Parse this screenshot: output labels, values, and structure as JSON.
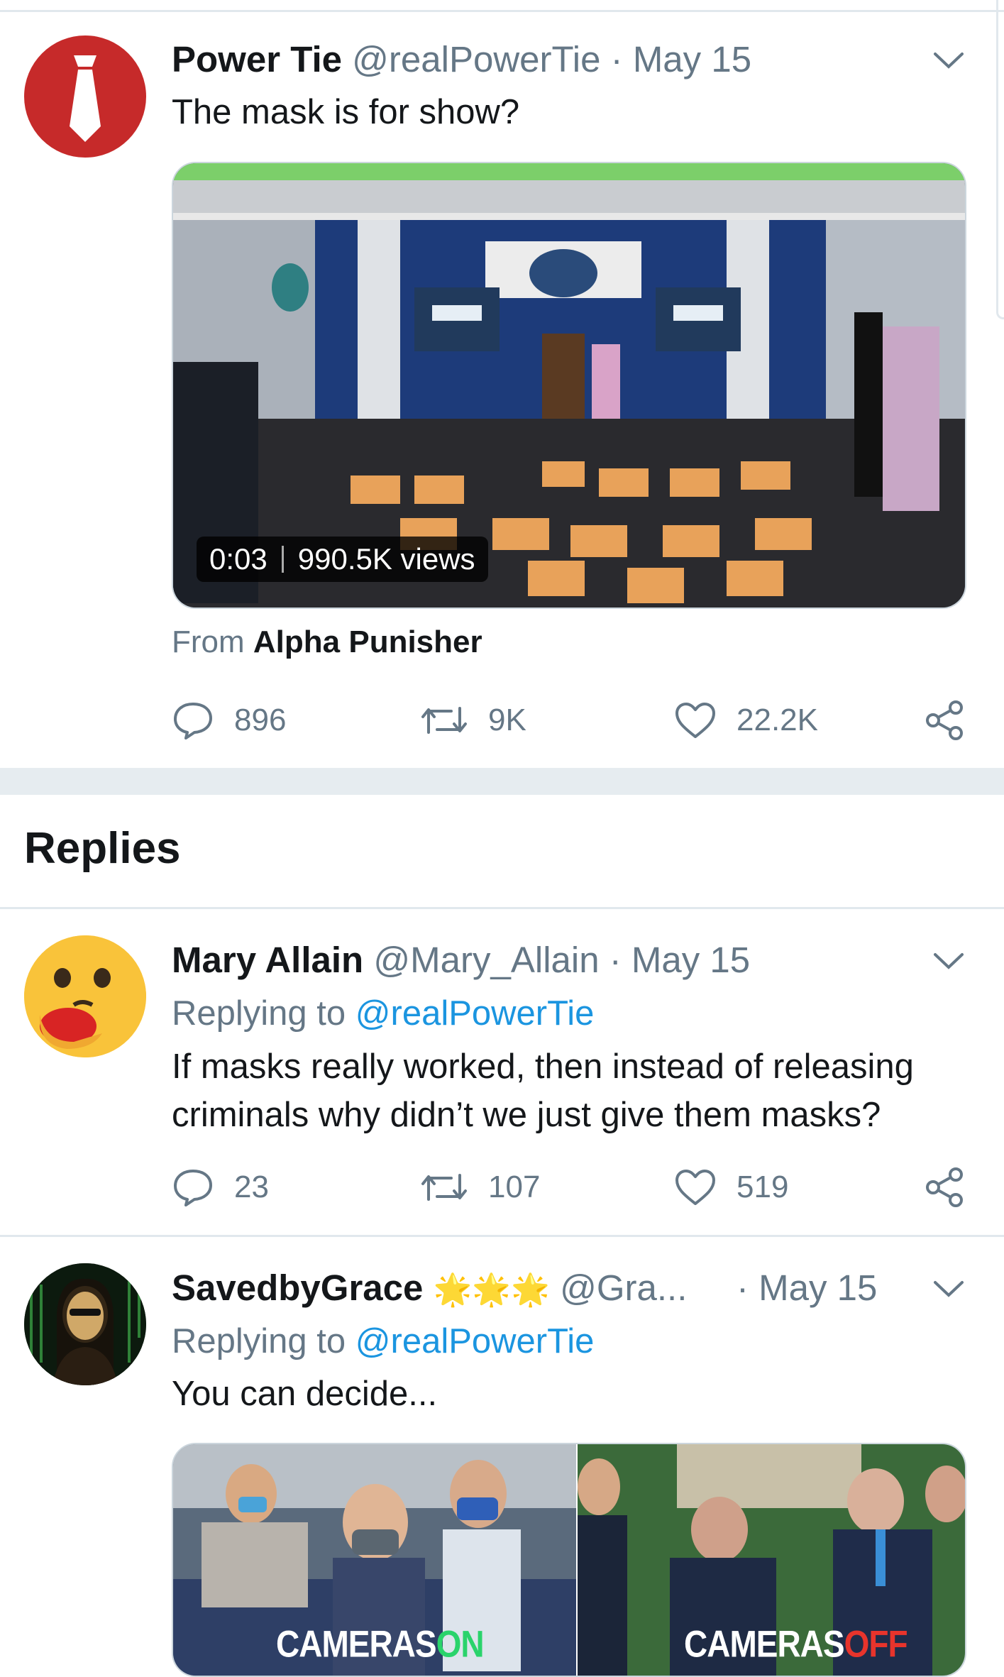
{
  "tweet": {
    "name": "Power Tie",
    "handle": "@realPowerTie",
    "dot": "·",
    "date": "May 15",
    "text": "The mask is for show?",
    "video": {
      "time": "0:03",
      "views": "990.5K views"
    },
    "from_prefix": "From",
    "from_name": "Alpha Punisher",
    "replies": "896",
    "retweets": "9K",
    "likes": "22.2K"
  },
  "section_title": "Replies",
  "reply1": {
    "name": "Mary Allain",
    "handle": "@Mary_Allain",
    "dot": "·",
    "date": "May 15",
    "replying_prefix": "Replying to",
    "replying_to": "@realPowerTie",
    "text_line1": "If masks really worked, then instead of releasing",
    "text_line2": "criminals why didn’t we just give them masks?",
    "replies": "23",
    "retweets": "107",
    "likes": "519"
  },
  "reply2": {
    "name": "SavedbyGrace",
    "stars": "🌟🌟🌟",
    "handle": "@Gra...",
    "dot": "·",
    "date": "May 15",
    "replying_prefix": "Replying to",
    "replying_to": "@realPowerTie",
    "text": "You can decide...",
    "meme_left_a": "CAMERAS",
    "meme_left_b": "ON",
    "meme_right_a": "CAMERAS",
    "meme_right_b": "OFF"
  },
  "colors": {
    "link": "#1b95e0",
    "muted": "#657786",
    "divider": "#e1e8ed"
  }
}
